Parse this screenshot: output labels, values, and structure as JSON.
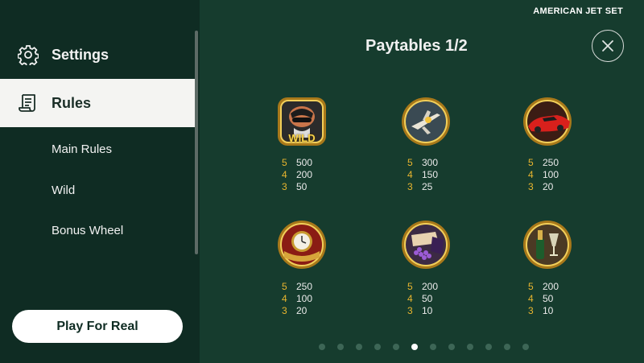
{
  "brand": "AMERICAN JET SET",
  "sidebar": {
    "settings_label": "Settings",
    "rules_label": "Rules",
    "sub_items": [
      "Main Rules",
      "Wild",
      "Bonus Wheel"
    ],
    "play_button": "Play For Real"
  },
  "paytable": {
    "title": "Paytables 1/2",
    "symbols": [
      {
        "icon": "wild-symbol-icon",
        "badge": "WILD",
        "pays": [
          {
            "count": "5",
            "amount": "500"
          },
          {
            "count": "4",
            "amount": "200"
          },
          {
            "count": "3",
            "amount": "50"
          }
        ]
      },
      {
        "icon": "jet-symbol-icon",
        "pays": [
          {
            "count": "5",
            "amount": "300"
          },
          {
            "count": "4",
            "amount": "150"
          },
          {
            "count": "3",
            "amount": "25"
          }
        ]
      },
      {
        "icon": "sports-car-symbol-icon",
        "pays": [
          {
            "count": "5",
            "amount": "250"
          },
          {
            "count": "4",
            "amount": "100"
          },
          {
            "count": "3",
            "amount": "20"
          }
        ]
      },
      {
        "icon": "gold-watch-symbol-icon",
        "pays": [
          {
            "count": "5",
            "amount": "250"
          },
          {
            "count": "4",
            "amount": "100"
          },
          {
            "count": "3",
            "amount": "20"
          }
        ]
      },
      {
        "icon": "purse-jewels-symbol-icon",
        "pays": [
          {
            "count": "5",
            "amount": "200"
          },
          {
            "count": "4",
            "amount": "50"
          },
          {
            "count": "3",
            "amount": "10"
          }
        ]
      },
      {
        "icon": "champagne-symbol-icon",
        "pays": [
          {
            "count": "5",
            "amount": "200"
          },
          {
            "count": "4",
            "amount": "50"
          },
          {
            "count": "3",
            "amount": "10"
          }
        ]
      }
    ]
  },
  "pagination": {
    "total": 12,
    "active_index": 5
  },
  "colors": {
    "background": "#163c2e",
    "sidebar": "#0f2c23",
    "accent_gold": "#e9b52e",
    "active_item_bg": "#f4f4f2"
  }
}
